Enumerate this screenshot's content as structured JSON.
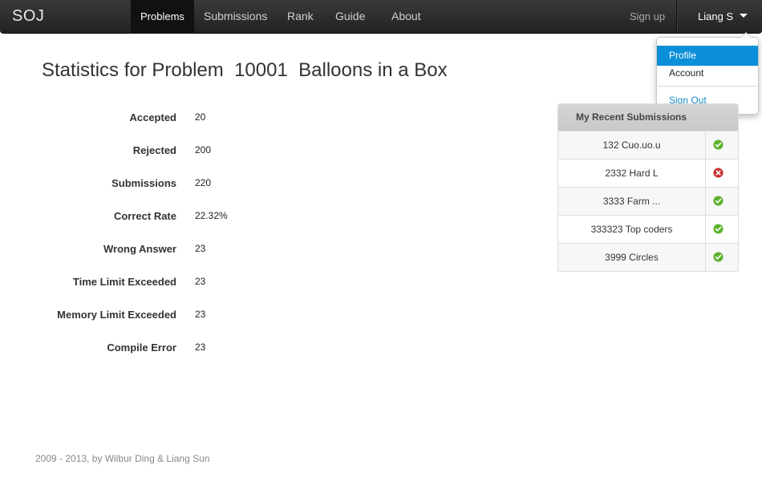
{
  "brand": "SOJ",
  "nav": {
    "items": [
      "Problems",
      "Submissions",
      "Rank",
      "Guide",
      "About"
    ],
    "signup": "Sign up",
    "user": "Liang S"
  },
  "dropdown": {
    "items": [
      "Profile",
      "Account",
      "Sign Out"
    ]
  },
  "title": "Statistics for Problem  10001  Balloons in a Box",
  "stats": [
    {
      "label": "Accepted",
      "value": "20"
    },
    {
      "label": "Rejected",
      "value": "200"
    },
    {
      "label": "Submissions",
      "value": "220"
    },
    {
      "label": "Correct Rate",
      "value": "22.32%"
    },
    {
      "label": "Wrong Answer",
      "value": "23"
    },
    {
      "label": "Time Limit Exceeded",
      "value": "23"
    },
    {
      "label": "Memory Limit Exceeded",
      "value": "23"
    },
    {
      "label": "Compile Error",
      "value": "23"
    }
  ],
  "recent": {
    "header": "My Recent Submissions",
    "rows": [
      {
        "name": "132 Cuo.uo.u",
        "status": "accepted"
      },
      {
        "name": "2332 Hard L",
        "status": "rejected"
      },
      {
        "name": "3333 Farm ...",
        "status": "accepted"
      },
      {
        "name": "333323 Top coders",
        "status": "accepted"
      },
      {
        "name": "3999 Circles",
        "status": "accepted"
      }
    ]
  },
  "colors": {
    "accepted": "#5cb32d",
    "rejected": "#c9302c",
    "highlight": "#0a8fd8"
  },
  "footer": "2009 - 2013, by Wilbur Ding & Liang Sun"
}
